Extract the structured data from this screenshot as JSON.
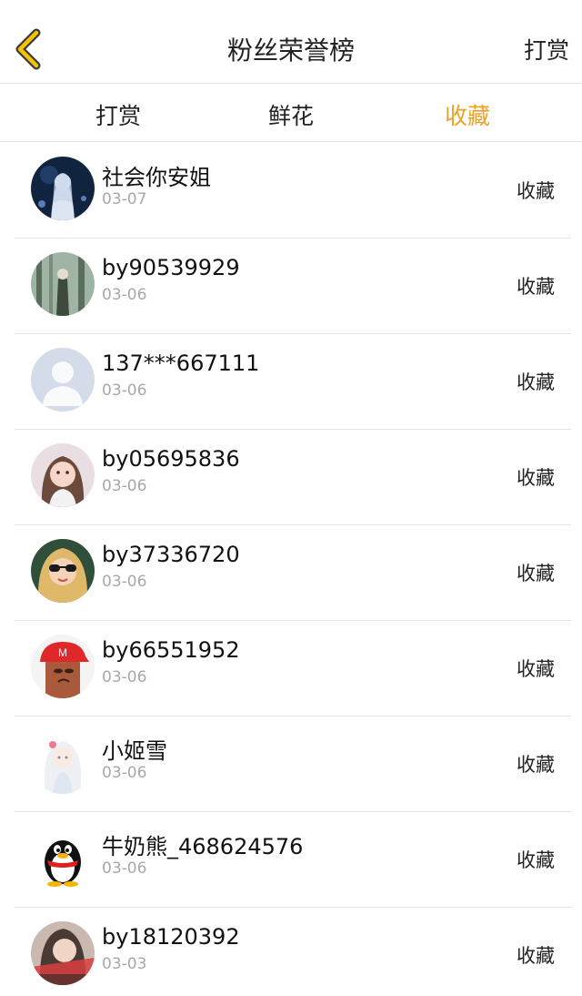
{
  "header": {
    "title": "粉丝荣誉榜",
    "right_action": "打赏",
    "accent_color": "#f0a020"
  },
  "tabs": [
    {
      "label": "打赏",
      "active": false
    },
    {
      "label": "鲜花",
      "active": false
    },
    {
      "label": "收藏",
      "active": true
    }
  ],
  "fans": [
    {
      "name": "社会你安姐",
      "date": "03-07",
      "label": "收藏",
      "avatar": "anime-girl-avatar"
    },
    {
      "name": "by90539929",
      "date": "03-06",
      "label": "收藏",
      "avatar": "forest-figure-avatar"
    },
    {
      "name": "137***667111",
      "date": "03-06",
      "label": "收藏",
      "avatar": "default-user-avatar"
    },
    {
      "name": "by05695836",
      "date": "03-06",
      "label": "收藏",
      "avatar": "little-girl-avatar"
    },
    {
      "name": "by37336720",
      "date": "03-06",
      "label": "收藏",
      "avatar": "sunglasses-girl-avatar"
    },
    {
      "name": "by66551952",
      "date": "03-06",
      "label": "收藏",
      "avatar": "red-cap-avatar"
    },
    {
      "name": "小姬雪",
      "date": "03-06",
      "label": "收藏",
      "avatar": "anime-white-hair-avatar"
    },
    {
      "name": "牛奶熊_468624576",
      "date": "03-06",
      "label": "收藏",
      "avatar": "qq-penguin-avatar"
    },
    {
      "name": "by18120392",
      "date": "03-03",
      "label": "收藏",
      "avatar": "photo-girl-avatar"
    }
  ]
}
